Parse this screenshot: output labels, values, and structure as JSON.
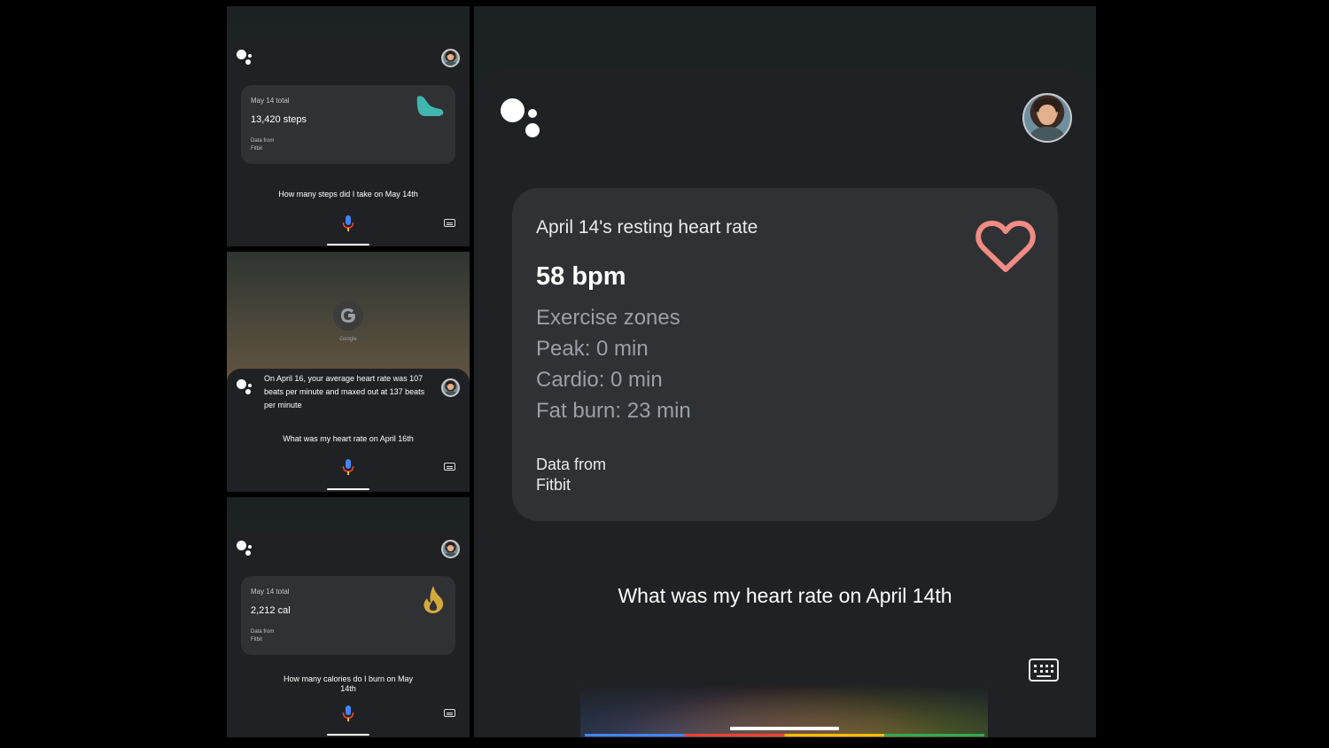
{
  "panel_steps": {
    "card_label": "May 14 total",
    "card_value": "13,420 steps",
    "source_label": "Data from",
    "source_name": "Fitbit",
    "icon": "shoe-icon",
    "query": "How many steps did I take on May 14th"
  },
  "panel_heart_avg": {
    "google_caption": "Google",
    "response": "On April 16, your average heart rate was 107 beats per minute and maxed out at 137 beats per minute",
    "query": "What was my heart rate on April 16th"
  },
  "panel_calories": {
    "card_label": "May 14 total",
    "card_value": "2,212 cal",
    "source_label": "Data from",
    "source_name": "Fitbit",
    "icon": "flame-icon",
    "query": "How many calories do I burn on May 14th"
  },
  "main_panel": {
    "card_title": "April 14's resting heart rate",
    "card_value": "58 bpm",
    "zones_title": "Exercise zones",
    "zones": [
      "Peak: 0 min",
      "Cardio: 0 min",
      "Fat burn: 23 min"
    ],
    "source_label": "Data from",
    "source_name": "Fitbit",
    "icon": "heart-icon",
    "query": "What was my heart rate on April 14th"
  },
  "colors": {
    "google_blue": "#4285f4",
    "google_red": "#ea4335",
    "google_yellow": "#fbbc05",
    "google_green": "#34a853",
    "card": "#303134",
    "sheet": "#202124",
    "heart": "#f08c84",
    "shoe": "#3fb6b0",
    "flame": "#d4a93c"
  }
}
